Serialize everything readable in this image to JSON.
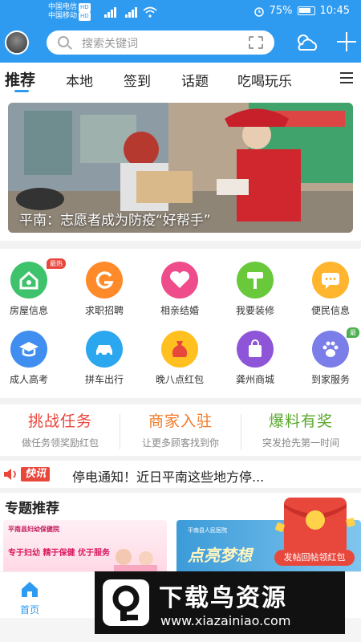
{
  "status_bar": {
    "carrier1": "中国电信",
    "carrier2": "中国移动",
    "battery": "75%",
    "time": "10:45"
  },
  "search": {
    "placeholder": "搜索关键词"
  },
  "tabs": [
    {
      "label": "推荐",
      "active": true
    },
    {
      "label": "本地"
    },
    {
      "label": "签到"
    },
    {
      "label": "话题"
    },
    {
      "label": "吃喝玩乐"
    }
  ],
  "banner": {
    "caption": "平南：志愿者成为防疫“好帮手”"
  },
  "grid": [
    {
      "label": "房屋信息",
      "icon": "house-icon",
      "color": "#3ec26b",
      "badge": "最热"
    },
    {
      "label": "求职招聘",
      "icon": "job-icon",
      "color": "#ff8a2a"
    },
    {
      "label": "相亲结婚",
      "icon": "heart-hands-icon",
      "color": "#ef4c8b"
    },
    {
      "label": "我要装修",
      "icon": "paint-roller-icon",
      "color": "#69c93a"
    },
    {
      "label": "便民信息",
      "icon": "chat-bubble-icon",
      "color": "#ffb52e"
    },
    {
      "label": "成人高考",
      "icon": "graduation-cap-icon",
      "color": "#3f8ef0"
    },
    {
      "label": "拼车出行",
      "icon": "car-icon",
      "color": "#2aa7ee"
    },
    {
      "label": "晚八点红包",
      "icon": "money-bag-icon",
      "color": "#ffc020"
    },
    {
      "label": "龚州商城",
      "icon": "shopping-bag-icon",
      "color": "#8e55d9"
    },
    {
      "label": "到家服务",
      "icon": "paw-icon",
      "color": "#7b7ee8",
      "badge": "最"
    }
  ],
  "promos": [
    {
      "title": "挑战任务",
      "sub": "做任务领奖励红包",
      "color": "#e8473c"
    },
    {
      "title": "商家入驻",
      "sub": "让更多顾客找到你",
      "color": "#f07a2a"
    },
    {
      "title": "爆料有奖",
      "sub": "突发抢先第一时间",
      "color": "#5aa82d"
    }
  ],
  "ticker": {
    "tag": "快讯",
    "text": "停电通知！近日平南这些地方停..."
  },
  "topics": {
    "title": "专题推荐",
    "card1_header": "平南县妇幼保健院",
    "card1_slogan": "专于妇幼 精于保健 优于服务",
    "card2_header": "平南县人民医院",
    "card2_big": "点亮梦想"
  },
  "redpack": {
    "label": "发帖回帖领红包"
  },
  "bottom": {
    "home_label": "首页"
  },
  "watermark": {
    "title": "下载鸟资源",
    "url": "www.xiazainiao.com"
  },
  "colors": {
    "primary": "#2f9bf0",
    "accent_red": "#e8473c"
  }
}
